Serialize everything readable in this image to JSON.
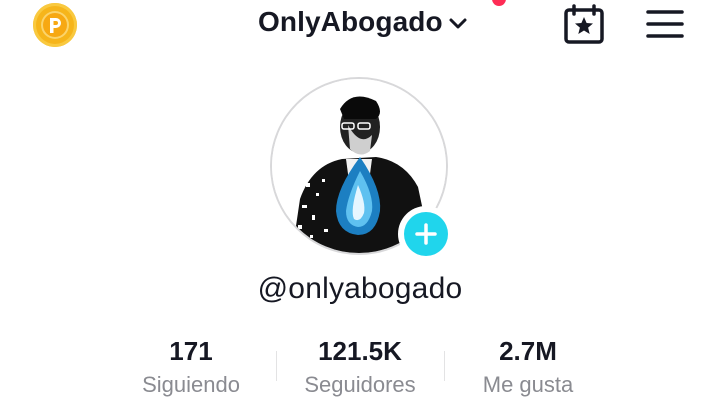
{
  "header": {
    "coin_icon": "coin-p-icon",
    "account_name": "OnlyAbogado",
    "chevron_icon": "chevron-down-icon",
    "calendar_icon": "calendar-star-icon",
    "menu_icon": "hamburger-menu-icon"
  },
  "profile": {
    "avatar": "profile-avatar",
    "add_icon": "plus-icon",
    "username": "@onlyabogado"
  },
  "stats": {
    "following": {
      "value": "171",
      "label": "Siguiendo"
    },
    "followers": {
      "value": "121.5K",
      "label": "Seguidores"
    },
    "likes": {
      "value": "2.7M",
      "label": "Me gusta"
    }
  },
  "colors": {
    "accent_cyan": "#20d5ec",
    "notification_red": "#fe2c55",
    "coin_gold": "#f6b51b",
    "text_primary": "#161823",
    "text_secondary": "#8a8b91"
  }
}
